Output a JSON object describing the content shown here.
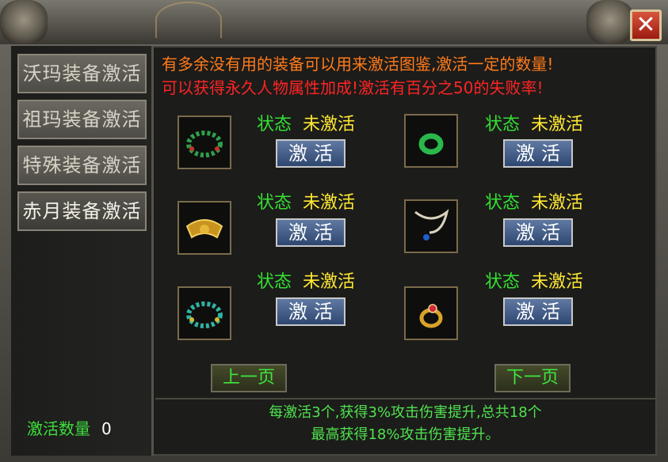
{
  "window": {
    "close_label": "✕"
  },
  "sidebar": {
    "tabs": [
      {
        "label": "沃玛装备激活"
      },
      {
        "label": "祖玛装备激活"
      },
      {
        "label": "特殊装备激活"
      },
      {
        "label": "赤月装备激活"
      }
    ]
  },
  "notice": {
    "line1": "有多余没有用的装备可以用来激活图鉴,激活一定的数量!",
    "line2": "可以获得永久人物属性加成!激活有百分之50的失败率!"
  },
  "items": [
    {
      "icon": "green-bead-bracelet-icon",
      "status_key": "状态",
      "status_value": "未激活",
      "button": "激活"
    },
    {
      "icon": "jade-ring-icon",
      "status_key": "状态",
      "status_value": "未激活",
      "button": "激活"
    },
    {
      "icon": "golden-bracer-icon",
      "status_key": "状态",
      "status_value": "未激活",
      "button": "激活"
    },
    {
      "icon": "sapphire-necklace-icon",
      "status_key": "状态",
      "status_value": "未激活",
      "button": "激活"
    },
    {
      "icon": "turquoise-bracelet-icon",
      "status_key": "状态",
      "status_value": "未激活",
      "button": "激活"
    },
    {
      "icon": "ruby-gold-ring-icon",
      "status_key": "状态",
      "status_value": "未激活",
      "button": "激活"
    }
  ],
  "pager": {
    "prev": "上一页",
    "next": "下一页"
  },
  "footer": {
    "line1": "每激活3个,获得3%攻击伤害提升,总共18个",
    "line2": "最高获得18%攻击伤害提升。"
  },
  "activation": {
    "label": "激活数量",
    "count": "0"
  },
  "colors": {
    "status_key": "#33e033",
    "status_value": "#ffe933",
    "notice1": "#ff7a1a",
    "notice2": "#ff2424",
    "button": "#2e4771"
  }
}
